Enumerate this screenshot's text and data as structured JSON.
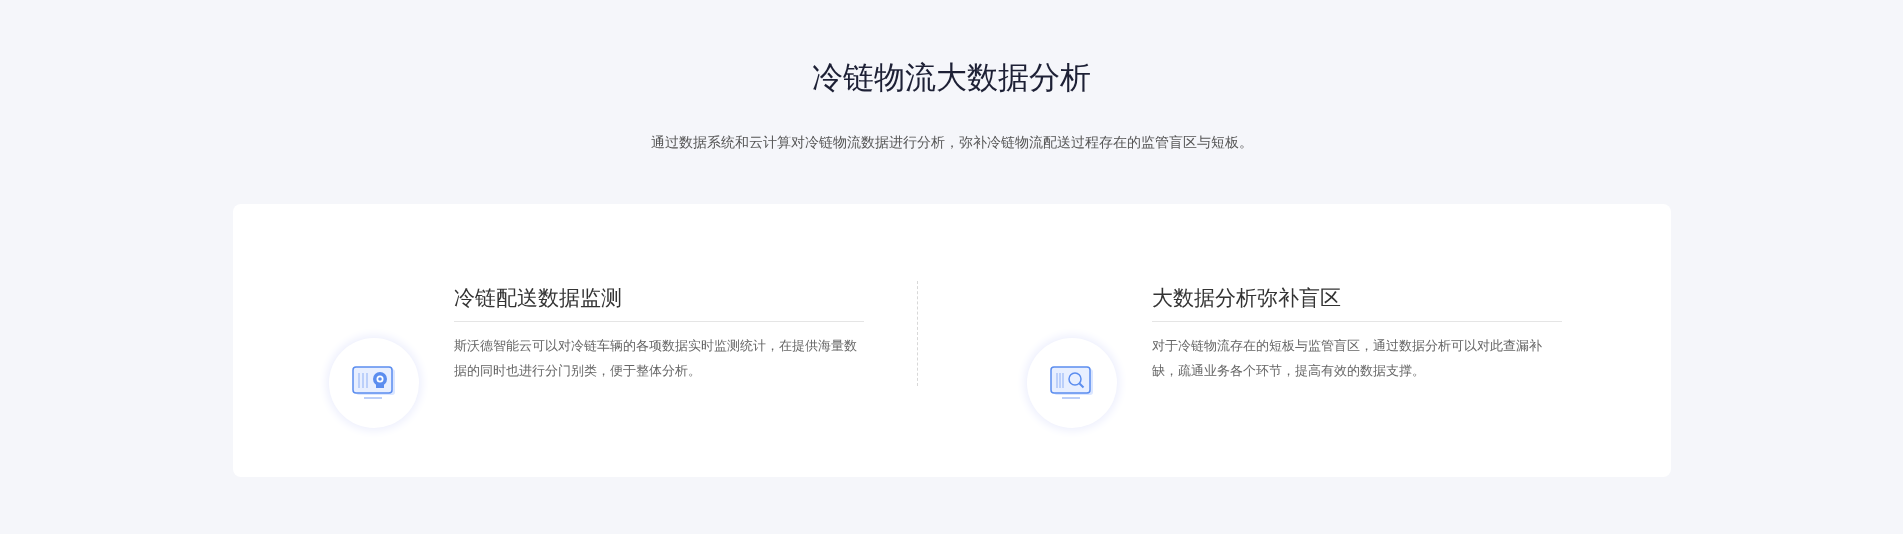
{
  "header": {
    "title": "冷链物流大数据分析",
    "subtitle": "通过数据系统和云计算对冷链物流数据进行分析，弥补冷链物流配送过程存在的监管盲区与短板。"
  },
  "features": [
    {
      "kind": "camera",
      "title": "冷链配送数据监测",
      "text": "斯沃德智能云可以对冷链车辆的各项数据实时监测统计，在提供海量数据的同时也进行分门别类，便于整体分析。"
    },
    {
      "kind": "search",
      "title": "大数据分析弥补盲区",
      "text": "对于冷链物流存在的短板与监管盲区，通过数据分析可以对此查漏补缺，疏通业务各个环节，提高有效的数据支撑。"
    }
  ]
}
